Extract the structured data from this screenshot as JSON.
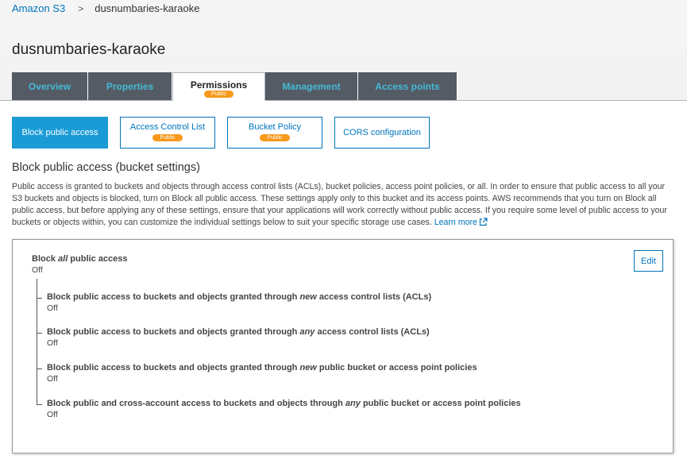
{
  "breadcrumb": {
    "root": "Amazon S3",
    "separator": ">",
    "current": "dusnumbaries-karaoke"
  },
  "page_title": "dusnumbaries-karaoke",
  "tabs": [
    {
      "label": "Overview"
    },
    {
      "label": "Properties"
    },
    {
      "label": "Permissions",
      "badge": "Public",
      "active": true
    },
    {
      "label": "Management"
    },
    {
      "label": "Access points"
    }
  ],
  "subtabs": [
    {
      "label": "Block public access",
      "active": true
    },
    {
      "label": "Access Control List",
      "badge": "Public"
    },
    {
      "label": "Bucket Policy",
      "badge": "Public"
    },
    {
      "label": "CORS configuration"
    }
  ],
  "section_heading": "Block public access (bucket settings)",
  "description": {
    "text": "Public access is granted to buckets and objects through access control lists (ACLs), bucket policies, access point policies, or all. In order to ensure that public access to all your S3 buckets and objects is blocked, turn on Block all public access. These settings apply only to this bucket and its access points. AWS recommends that you turn on Block all public access, but before applying any of these settings, ensure that your applications will work correctly without public access. If you require some level of public access to your buckets or objects within, you can customize the individual settings below to suit your specific storage use cases.",
    "learn_more": "Learn more"
  },
  "settings": {
    "edit_label": "Edit",
    "master": {
      "label_pre": "Block ",
      "label_em": "all",
      "label_post": " public access",
      "value": "Off"
    },
    "items": [
      {
        "label_pre": "Block public access to buckets and objects granted through ",
        "label_em": "new",
        "label_post": " access control lists (ACLs)",
        "value": "Off"
      },
      {
        "label_pre": "Block public access to buckets and objects granted through ",
        "label_em": "any",
        "label_post": " access control lists (ACLs)",
        "value": "Off"
      },
      {
        "label_pre": "Block public access to buckets and objects granted through ",
        "label_em": "new",
        "label_post": " public bucket or access point policies",
        "value": "Off"
      },
      {
        "label_pre": "Block public and cross-account access to buckets and objects through ",
        "label_em": "any",
        "label_post": " public bucket or access point policies",
        "value": "Off"
      }
    ]
  },
  "colors": {
    "link": "#0073bb",
    "tab_bg": "#545b64",
    "tab_text": "#44b9d6",
    "badge": "#f7991c",
    "active_subtab": "#1a9bd6"
  },
  "icons": {
    "external_link": "external-link-icon"
  }
}
